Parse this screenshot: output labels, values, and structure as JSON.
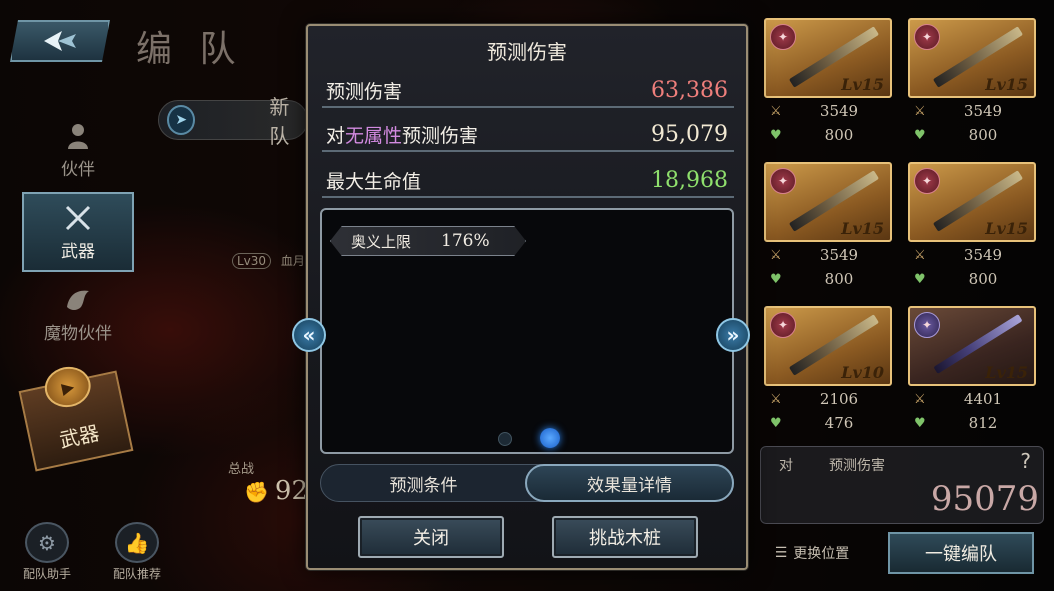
{
  "colors": {
    "damage": "#ef7f7c",
    "attribute_damage": "#f3ead4",
    "max_hp": "#8fe06d",
    "attribute_highlight": "#d28ae0",
    "accent_blue": "#6f95a6"
  },
  "header": {
    "title": "编 队",
    "back_icon": "back-arrow-icon"
  },
  "side_nav": {
    "items": [
      {
        "label": "伙伴",
        "icon": "partner-icon",
        "active": false
      },
      {
        "label": "武器",
        "icon": "crossed-swords-icon",
        "active": true
      },
      {
        "label": "魔物伙伴",
        "icon": "monster-icon",
        "active": false
      }
    ],
    "badge_label": "武器"
  },
  "background": {
    "team_name": "新队",
    "level_pill": "Lv30",
    "level_text": "血月",
    "power_label": "总战",
    "power_value": "92"
  },
  "bottom_left": {
    "helper_label": "配队助手",
    "recommend_label": "配队推荐"
  },
  "weapons": [
    {
      "level": "Lv15",
      "attack": "3549",
      "hp": "800",
      "element": "fire"
    },
    {
      "level": "Lv15",
      "attack": "3549",
      "hp": "800",
      "element": "fire"
    },
    {
      "level": "Lv15",
      "attack": "3549",
      "hp": "800",
      "element": "fire"
    },
    {
      "level": "Lv15",
      "attack": "3549",
      "hp": "800",
      "element": "fire"
    },
    {
      "level": "Lv10",
      "attack": "2106",
      "hp": "476",
      "element": "fire"
    },
    {
      "level": "Lv15",
      "attack": "4401",
      "hp": "812",
      "element": "void"
    }
  ],
  "damage_panel": {
    "prefix": "对",
    "label": "预测伤害",
    "help": "?",
    "value": "95079"
  },
  "bottom_right": {
    "swap_label": "更换位置",
    "one_key_label": "一键编队"
  },
  "modal": {
    "title": "预测伤害",
    "rows": [
      {
        "label": "预测伤害",
        "value": "63,386"
      },
      {
        "label_prefix": "对",
        "label_highlight": "无属性",
        "label_suffix": "预测伤害",
        "value": "95,079"
      },
      {
        "label": "最大生命值",
        "value": "18,968"
      }
    ],
    "limit_label": "奥义上限",
    "limit_value": "176%",
    "page_dots": {
      "count": 2,
      "active_index": 1
    },
    "tabs": [
      {
        "label": "预测条件",
        "active": false
      },
      {
        "label": "效果量详情",
        "active": true
      }
    ],
    "close_label": "关闭",
    "dummy_label": "挑战木桩",
    "prev_arrow": "«",
    "next_arrow": "»"
  }
}
